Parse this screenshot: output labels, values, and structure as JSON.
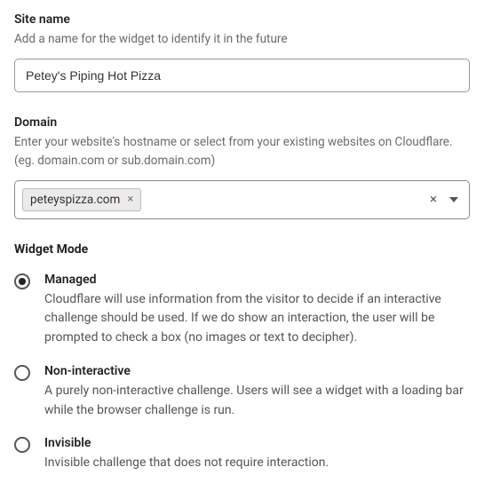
{
  "siteName": {
    "label": "Site name",
    "description": "Add a name for the widget to identify it in the future",
    "value": "Petey's Piping Hot Pizza"
  },
  "domain": {
    "label": "Domain",
    "description": "Enter your website's hostname or select from your existing websites on Cloudflare. (eg. domain.com or sub.domain.com)",
    "chipText": "peteyspizza.com",
    "chipClose": "×",
    "clearAll": "×"
  },
  "widgetMode": {
    "heading": "Widget Mode",
    "options": [
      {
        "title": "Managed",
        "description": "Cloudflare will use information from the visitor to decide if an interactive challenge should be used. If we do show an interaction, the user will be prompted to check a box (no images or text to decipher).",
        "selected": true
      },
      {
        "title": "Non-interactive",
        "description": "A purely non-interactive challenge. Users will see a widget with a loading bar while the browser challenge is run.",
        "selected": false
      },
      {
        "title": "Invisible",
        "description": "Invisible challenge that does not require interaction.",
        "selected": false
      }
    ]
  }
}
